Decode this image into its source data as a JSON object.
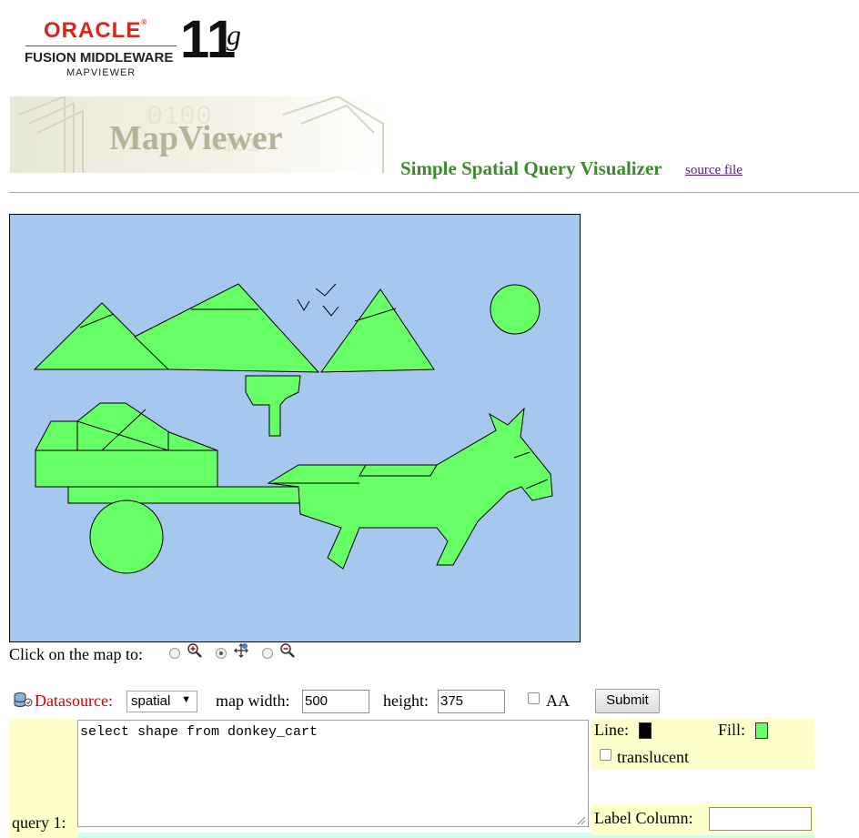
{
  "logo": {
    "brand": "ORACLE",
    "line2": "FUSION MIDDLEWARE",
    "line3": "MAPVIEWER",
    "version": "11",
    "version_suffix": "g"
  },
  "banner": {
    "text": "MapViewer"
  },
  "header": {
    "title": "Simple Spatial Query Visualizer",
    "source_link": "source file"
  },
  "map": {
    "background_color": "#a6c8ef",
    "fill_color": "#66ff66",
    "line_color": "#000000"
  },
  "map_tools": {
    "label": "Click on the map to:",
    "options": [
      {
        "icon": "zoom-in-icon",
        "selected": false
      },
      {
        "icon": "pan-icon",
        "selected": true
      },
      {
        "icon": "zoom-out-icon",
        "selected": false
      }
    ]
  },
  "controls": {
    "datasource_label": "Datasource:",
    "datasource_value": "spatial",
    "width_label": "map width:",
    "width_value": "500",
    "height_label": "height:",
    "height_value": "375",
    "aa_label": "AA",
    "aa_checked": false,
    "submit_label": "Submit"
  },
  "query": {
    "label": "query 1:",
    "sql": "select shape from donkey_cart",
    "line_label": "Line:",
    "line_color": "#000000",
    "fill_label": "Fill:",
    "fill_color": "#66ff66",
    "translucent_label": "translucent",
    "translucent_checked": false,
    "label_column_label": "Label Column:",
    "label_column_value": ""
  }
}
